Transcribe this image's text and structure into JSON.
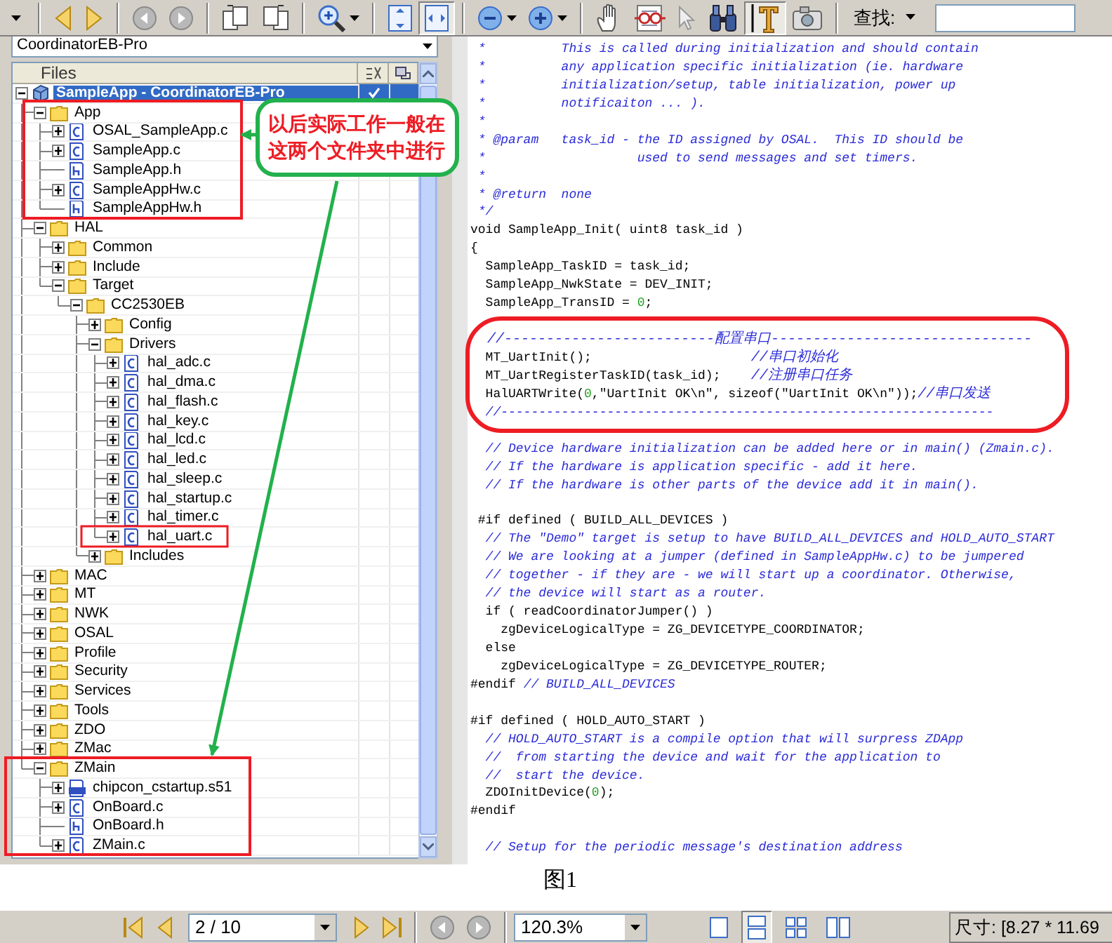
{
  "toolbar": {
    "groups": [
      [
        {
          "kind": "caret",
          "selected": false,
          "menu": false
        }
      ],
      [
        {
          "kind": "back",
          "selected": false,
          "menu": false
        },
        {
          "kind": "forward",
          "selected": false,
          "menu": false
        }
      ],
      [
        {
          "kind": "nav-back",
          "selected": false,
          "menu": false
        },
        {
          "kind": "nav-forward",
          "selected": false,
          "menu": false
        }
      ],
      [
        {
          "kind": "rotate-left",
          "selected": false,
          "menu": false
        },
        {
          "kind": "rotate-right",
          "selected": false,
          "menu": false
        }
      ],
      [
        {
          "kind": "zoom-tool",
          "selected": false,
          "menu": true
        }
      ],
      [
        {
          "kind": "fit-page",
          "selected": false,
          "menu": false
        },
        {
          "kind": "fit-width",
          "selected": true,
          "menu": false
        }
      ],
      [
        {
          "kind": "zoom-out",
          "selected": false,
          "menu": true
        },
        {
          "kind": "zoom-in",
          "selected": false,
          "menu": true
        }
      ],
      [
        {
          "kind": "hand",
          "selected": false,
          "menu": false
        },
        {
          "kind": "glasses",
          "selected": false,
          "menu": false
        },
        {
          "kind": "pointer",
          "selected": false,
          "menu": false
        },
        {
          "kind": "binoculars",
          "selected": false,
          "menu": false
        },
        {
          "kind": "text-select",
          "selected": true,
          "menu": false
        },
        {
          "kind": "camera",
          "selected": false,
          "menu": false
        }
      ]
    ],
    "find_label": "查找:"
  },
  "workspace": {
    "configuration": "CoordinatorEB-Pro",
    "files_header": "Files"
  },
  "tree": [
    {
      "label": "SampleApp - CoordinatorEB-Pro",
      "kind": "project",
      "expandable": true,
      "expanded": true,
      "selected": true,
      "checked": true,
      "children": [
        {
          "label": "App",
          "kind": "folder",
          "expandable": true,
          "expanded": true,
          "selected": false,
          "checked": false,
          "children": [
            {
              "label": "OSAL_SampleApp.c",
              "kind": "c",
              "expandable": true,
              "expanded": false,
              "selected": false,
              "checked": false
            },
            {
              "label": "SampleApp.c",
              "kind": "c",
              "expandable": true,
              "expanded": false,
              "selected": false,
              "checked": false
            },
            {
              "label": "SampleApp.h",
              "kind": "h",
              "expandable": false,
              "selected": false,
              "checked": false
            },
            {
              "label": "SampleAppHw.c",
              "kind": "c",
              "expandable": true,
              "expanded": false,
              "selected": false,
              "checked": false
            },
            {
              "label": "SampleAppHw.h",
              "kind": "h",
              "expandable": false,
              "selected": false,
              "checked": false
            }
          ]
        },
        {
          "label": "HAL",
          "kind": "folder",
          "expandable": true,
          "expanded": true,
          "selected": false,
          "checked": false,
          "children": [
            {
              "label": "Common",
              "kind": "folder",
              "expandable": true,
              "expanded": false,
              "selected": false,
              "checked": false
            },
            {
              "label": "Include",
              "kind": "folder",
              "expandable": true,
              "expanded": false,
              "selected": false,
              "checked": false
            },
            {
              "label": "Target",
              "kind": "folder",
              "expandable": true,
              "expanded": true,
              "selected": false,
              "checked": false,
              "children": [
                {
                  "label": "CC2530EB",
                  "kind": "folder",
                  "expandable": true,
                  "expanded": true,
                  "selected": false,
                  "checked": false,
                  "children": [
                    {
                      "label": "Config",
                      "kind": "folder",
                      "expandable": true,
                      "expanded": false,
                      "selected": false,
                      "checked": false
                    },
                    {
                      "label": "Drivers",
                      "kind": "folder",
                      "expandable": true,
                      "expanded": true,
                      "selected": false,
                      "checked": false,
                      "children": [
                        {
                          "label": "hal_adc.c",
                          "kind": "c",
                          "expandable": true,
                          "expanded": false,
                          "selected": false,
                          "checked": false
                        },
                        {
                          "label": "hal_dma.c",
                          "kind": "c",
                          "expandable": true,
                          "expanded": false,
                          "selected": false,
                          "checked": false
                        },
                        {
                          "label": "hal_flash.c",
                          "kind": "c",
                          "expandable": true,
                          "expanded": false,
                          "selected": false,
                          "checked": false
                        },
                        {
                          "label": "hal_key.c",
                          "kind": "c",
                          "expandable": true,
                          "expanded": false,
                          "selected": false,
                          "checked": false
                        },
                        {
                          "label": "hal_lcd.c",
                          "kind": "c",
                          "expandable": true,
                          "expanded": false,
                          "selected": false,
                          "checked": false
                        },
                        {
                          "label": "hal_led.c",
                          "kind": "c",
                          "expandable": true,
                          "expanded": false,
                          "selected": false,
                          "checked": false
                        },
                        {
                          "label": "hal_sleep.c",
                          "kind": "c",
                          "expandable": true,
                          "expanded": false,
                          "selected": false,
                          "checked": false
                        },
                        {
                          "label": "hal_startup.c",
                          "kind": "c",
                          "expandable": true,
                          "expanded": false,
                          "selected": false,
                          "checked": false
                        },
                        {
                          "label": "hal_timer.c",
                          "kind": "c",
                          "expandable": true,
                          "expanded": false,
                          "selected": false,
                          "checked": false
                        },
                        {
                          "label": "hal_uart.c",
                          "kind": "c",
                          "expandable": true,
                          "expanded": false,
                          "selected": false,
                          "checked": false
                        }
                      ]
                    },
                    {
                      "label": "Includes",
                      "kind": "folder",
                      "expandable": true,
                      "expanded": false,
                      "selected": false,
                      "checked": false
                    }
                  ]
                }
              ]
            }
          ]
        },
        {
          "label": "MAC",
          "kind": "folder",
          "expandable": true,
          "expanded": false,
          "selected": false,
          "checked": false
        },
        {
          "label": "MT",
          "kind": "folder",
          "expandable": true,
          "expanded": false,
          "selected": false,
          "checked": false
        },
        {
          "label": "NWK",
          "kind": "folder",
          "expandable": true,
          "expanded": false,
          "selected": false,
          "checked": false
        },
        {
          "label": "OSAL",
          "kind": "folder",
          "expandable": true,
          "expanded": false,
          "selected": false,
          "checked": false
        },
        {
          "label": "Profile",
          "kind": "folder",
          "expandable": true,
          "expanded": false,
          "selected": false,
          "checked": false
        },
        {
          "label": "Security",
          "kind": "folder",
          "expandable": true,
          "expanded": false,
          "selected": false,
          "checked": false
        },
        {
          "label": "Services",
          "kind": "folder",
          "expandable": true,
          "expanded": false,
          "selected": false,
          "checked": false
        },
        {
          "label": "Tools",
          "kind": "folder",
          "expandable": true,
          "expanded": false,
          "selected": false,
          "checked": false
        },
        {
          "label": "ZDO",
          "kind": "folder",
          "expandable": true,
          "expanded": false,
          "selected": false,
          "checked": false
        },
        {
          "label": "ZMac",
          "kind": "folder",
          "expandable": true,
          "expanded": false,
          "selected": false,
          "checked": false
        },
        {
          "label": "ZMain",
          "kind": "folder",
          "expandable": true,
          "expanded": true,
          "selected": false,
          "checked": false,
          "children": [
            {
              "label": "chipcon_cstartup.s51",
              "kind": "asm",
              "expandable": true,
              "expanded": false,
              "selected": false,
              "checked": false
            },
            {
              "label": "OnBoard.c",
              "kind": "c",
              "expandable": true,
              "expanded": false,
              "selected": false,
              "checked": false
            },
            {
              "label": "OnBoard.h",
              "kind": "h",
              "expandable": false,
              "selected": false,
              "checked": false
            },
            {
              "label": "ZMain.c",
              "kind": "c",
              "expandable": true,
              "expanded": false,
              "selected": false,
              "checked": false
            }
          ]
        }
      ]
    }
  ],
  "callout": "以后实际工作一般在这两个文件夹中进行",
  "code": [
    {
      "kind": "text",
      "segments": [
        {
          "kind": "comment",
          "text": " *          This is called during initialization and should contain"
        }
      ]
    },
    {
      "kind": "text",
      "segments": [
        {
          "kind": "comment",
          "text": " *          any application specific initialization (ie. hardware"
        }
      ]
    },
    {
      "kind": "text",
      "segments": [
        {
          "kind": "comment",
          "text": " *          initialization/setup, table initialization, power up"
        }
      ]
    },
    {
      "kind": "text",
      "segments": [
        {
          "kind": "comment",
          "text": " *          notificaiton ... )."
        }
      ]
    },
    {
      "kind": "text",
      "segments": [
        {
          "kind": "comment",
          "text": " *"
        }
      ]
    },
    {
      "kind": "text",
      "segments": [
        {
          "kind": "comment",
          "text": " * @param   task_id - the ID assigned by OSAL.  This ID should be"
        }
      ]
    },
    {
      "kind": "text",
      "segments": [
        {
          "kind": "comment",
          "text": " *                    used to send messages and set timers."
        }
      ]
    },
    {
      "kind": "text",
      "segments": [
        {
          "kind": "comment",
          "text": " *"
        }
      ]
    },
    {
      "kind": "text",
      "segments": [
        {
          "kind": "comment",
          "text": " * @return  none"
        }
      ]
    },
    {
      "kind": "text",
      "segments": [
        {
          "kind": "comment",
          "text": " */"
        }
      ]
    },
    {
      "kind": "text",
      "segments": [
        {
          "kind": "code",
          "text": "void SampleApp_Init( uint8 task_id )"
        }
      ]
    },
    {
      "kind": "text",
      "segments": [
        {
          "kind": "code",
          "text": "{"
        }
      ]
    },
    {
      "kind": "text",
      "segments": [
        {
          "kind": "code",
          "text": "  SampleApp_TaskID = task_id;"
        }
      ]
    },
    {
      "kind": "text",
      "segments": [
        {
          "kind": "code",
          "text": "  SampleApp_NwkState = DEV_INIT;"
        }
      ]
    },
    {
      "kind": "text",
      "segments": [
        {
          "kind": "code",
          "text": "  SampleApp_TransID = "
        },
        {
          "kind": "number",
          "text": "0"
        },
        {
          "kind": "code",
          "text": ";"
        }
      ]
    },
    {
      "kind": "blank"
    },
    {
      "kind": "text",
      "segments": [
        {
          "kind": "comment",
          "text": "  //-------------------------配置串口-------------------------------"
        }
      ]
    },
    {
      "kind": "text",
      "segments": [
        {
          "kind": "code",
          "text": "  MT_UartInit();                     "
        },
        {
          "kind": "comment",
          "text": "//串口初始化"
        }
      ]
    },
    {
      "kind": "text",
      "segments": [
        {
          "kind": "code",
          "text": "  MT_UartRegisterTaskID(task_id);    "
        },
        {
          "kind": "comment",
          "text": "//注册串口任务"
        }
      ]
    },
    {
      "kind": "text",
      "segments": [
        {
          "kind": "code",
          "text": "  HalUARTWrite("
        },
        {
          "kind": "number",
          "text": "0"
        },
        {
          "kind": "code",
          "text": ",\"UartInit OK\\n\", sizeof(\"UartInit OK\\n\"));"
        },
        {
          "kind": "comment",
          "text": "//串口发送"
        }
      ]
    },
    {
      "kind": "text",
      "segments": [
        {
          "kind": "comment",
          "text": "  //-----------------------------------------------------------------"
        }
      ]
    },
    {
      "kind": "blank"
    },
    {
      "kind": "text",
      "segments": [
        {
          "kind": "comment",
          "text": "  // Device hardware initialization can be added here or in main() (Zmain.c)."
        }
      ]
    },
    {
      "kind": "text",
      "segments": [
        {
          "kind": "comment",
          "text": "  // If the hardware is application specific - add it here."
        }
      ]
    },
    {
      "kind": "text",
      "segments": [
        {
          "kind": "comment",
          "text": "  // If the hardware is other parts of the device add it in main()."
        }
      ]
    },
    {
      "kind": "blank"
    },
    {
      "kind": "text",
      "segments": [
        {
          "kind": "code",
          "text": " #if defined ( BUILD_ALL_DEVICES )"
        }
      ]
    },
    {
      "kind": "text",
      "segments": [
        {
          "kind": "comment",
          "text": "  // The \"Demo\" target is setup to have BUILD_ALL_DEVICES and HOLD_AUTO_START"
        }
      ]
    },
    {
      "kind": "text",
      "segments": [
        {
          "kind": "comment",
          "text": "  // We are looking at a jumper (defined in SampleAppHw.c) to be jumpered"
        }
      ]
    },
    {
      "kind": "text",
      "segments": [
        {
          "kind": "comment",
          "text": "  // together - if they are - we will start up a coordinator. Otherwise,"
        }
      ]
    },
    {
      "kind": "text",
      "segments": [
        {
          "kind": "comment",
          "text": "  // the device will start as a router."
        }
      ]
    },
    {
      "kind": "text",
      "segments": [
        {
          "kind": "code",
          "text": "  if ( readCoordinatorJumper() )"
        }
      ]
    },
    {
      "kind": "text",
      "segments": [
        {
          "kind": "code",
          "text": "    zgDeviceLogicalType = ZG_DEVICETYPE_COORDINATOR;"
        }
      ]
    },
    {
      "kind": "text",
      "segments": [
        {
          "kind": "code",
          "text": "  else"
        }
      ]
    },
    {
      "kind": "text",
      "segments": [
        {
          "kind": "code",
          "text": "    zgDeviceLogicalType = ZG_DEVICETYPE_ROUTER;"
        }
      ]
    },
    {
      "kind": "text",
      "segments": [
        {
          "kind": "code",
          "text": "#endif "
        },
        {
          "kind": "comment",
          "text": "// BUILD_ALL_DEVICES"
        }
      ]
    },
    {
      "kind": "blank"
    },
    {
      "kind": "text",
      "segments": [
        {
          "kind": "code",
          "text": "#if defined ( HOLD_AUTO_START )"
        }
      ]
    },
    {
      "kind": "text",
      "segments": [
        {
          "kind": "comment",
          "text": "  // HOLD_AUTO_START is a compile option that will surpress ZDApp"
        }
      ]
    },
    {
      "kind": "text",
      "segments": [
        {
          "kind": "comment",
          "text": "  //  from starting the device and wait for the application to"
        }
      ]
    },
    {
      "kind": "text",
      "segments": [
        {
          "kind": "comment",
          "text": "  //  start the device."
        }
      ]
    },
    {
      "kind": "text",
      "segments": [
        {
          "kind": "code",
          "text": "  ZDOInitDevice("
        },
        {
          "kind": "number",
          "text": "0"
        },
        {
          "kind": "code",
          "text": ");"
        }
      ]
    },
    {
      "kind": "text",
      "segments": [
        {
          "kind": "code",
          "text": "#endif"
        }
      ]
    },
    {
      "kind": "blank"
    },
    {
      "kind": "text",
      "segments": [
        {
          "kind": "comment",
          "text": "  // Setup for the periodic message's destination address"
        }
      ]
    }
  ],
  "caption": "图1",
  "statusbar": {
    "before": [
      {
        "kind": "first-page"
      },
      {
        "kind": "previous-page"
      }
    ],
    "page": "2 / 10",
    "after": [
      {
        "kind": "next-page"
      },
      {
        "kind": "last-page"
      }
    ],
    "history": [
      {
        "kind": "nav-back"
      },
      {
        "kind": "nav-forward"
      }
    ],
    "zoom": "120.3%",
    "views": [
      {
        "kind": "single",
        "selected": false
      },
      {
        "kind": "continuous",
        "selected": true
      },
      {
        "kind": "grid",
        "selected": false
      },
      {
        "kind": "facing",
        "selected": false
      }
    ],
    "size": "尺寸: [8.27 * 11.69"
  }
}
